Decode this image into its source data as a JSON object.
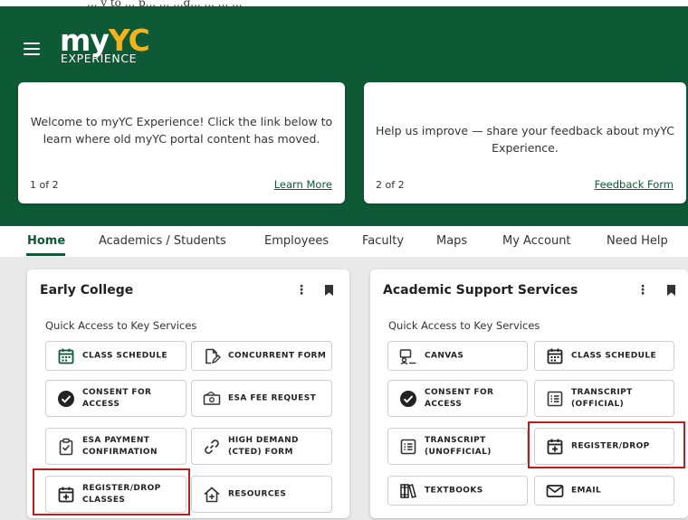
{
  "top_cropped_text": "... y to ... p... ... ...g... ... ... ...",
  "header": {
    "logo_my": "my",
    "logo_yc": "YC",
    "logo_sub": "EXPERIENCE"
  },
  "banners": [
    {
      "message": "Welcome to myYC Experience! Click the link below to learn where old myYC portal content has moved.",
      "count": "1 of 2",
      "link": "Learn More"
    },
    {
      "message": "Help us improve — share your feedback about myYC Experience.",
      "count": "2 of 2",
      "link": "Feedback Form"
    }
  ],
  "tabs": [
    "Home",
    "Academics / Students",
    "Employees",
    "Faculty",
    "Maps",
    "My Account",
    "Need Help"
  ],
  "cards": [
    {
      "title": "Early College",
      "subtitle": "Quick Access to Key Services",
      "services": [
        {
          "label": "CLASS SCHEDULE",
          "icon": "calendar-icon"
        },
        {
          "label": "CONCURRENT FORM",
          "icon": "document-edit-icon"
        },
        {
          "label": "CONSENT FOR ACCESS",
          "icon": "check-circle-icon"
        },
        {
          "label": "ESA FEE REQUEST",
          "icon": "money-icon"
        },
        {
          "label": "ESA PAYMENT CONFIRMATION",
          "icon": "clipboard-check-icon"
        },
        {
          "label": "HIGH DEMAND (CTED) FORM",
          "icon": "link-icon"
        },
        {
          "label": "REGISTER/DROP CLASSES",
          "icon": "calendar-plus-icon"
        },
        {
          "label": "RESOURCES",
          "icon": "house-plus-icon"
        }
      ]
    },
    {
      "title": "Academic Support Services",
      "subtitle": "Quick Access to Key Services",
      "services": [
        {
          "label": "CANVAS",
          "icon": "canvas-icon"
        },
        {
          "label": "CLASS SCHEDULE",
          "icon": "calendar-icon"
        },
        {
          "label": "CONSENT FOR ACCESS",
          "icon": "check-circle-icon"
        },
        {
          "label": "TRANSCRIPT (OFFICIAL)",
          "icon": "list-icon"
        },
        {
          "label": "TRANSCRIPT (UNOFFICIAL)",
          "icon": "list-icon"
        },
        {
          "label": "REGISTER/DROP",
          "icon": "calendar-plus-icon"
        },
        {
          "label": "TEXTBOOKS",
          "icon": "books-icon"
        },
        {
          "label": "EMAIL",
          "icon": "envelope-icon"
        }
      ]
    }
  ],
  "colors": {
    "brand_green": "#0e5a36",
    "brand_gold": "#f2b31c",
    "highlight_red": "#b8201e"
  }
}
